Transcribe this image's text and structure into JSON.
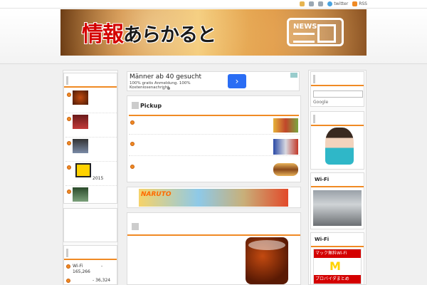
{
  "topbar": {
    "links": [
      {
        "label": "twitter",
        "icon": "twitter-icon"
      },
      {
        "label": "RSS",
        "icon": "rss-icon"
      }
    ]
  },
  "banner": {
    "title_kanji": "情報",
    "title_kana": "あらかると",
    "badge": "NEWS"
  },
  "ad": {
    "headline": "Männer ab 40 gesucht",
    "body": "100% gratis Anmeldung. 100% Kostenlosenachricht",
    "cta": "›"
  },
  "pickup": {
    "title": "Pickup"
  },
  "anime": {
    "logo": "NARUTO"
  },
  "left": {
    "items": [
      {
        "label": ""
      },
      {
        "label": ""
      },
      {
        "label": ""
      },
      {
        "label": "2015"
      },
      {
        "label": ""
      }
    ],
    "stats": [
      {
        "label": "Wi-Fi",
        "dash": "-",
        "value": "165,266"
      },
      {
        "label": "",
        "dash": "-",
        "value": "36,324"
      }
    ]
  },
  "right": {
    "google_label": "Google",
    "wifi1_title": "Wi-Fi",
    "wifi2_title": "Wi-Fi",
    "mac_top": "マック無料Wi-Fi",
    "mac_bottom": "プロバイダまとめ",
    "mac_logo": "M"
  },
  "colors": {
    "accent": "#f08a24",
    "brand_red": "#d40000",
    "ad_blue": "#2a6df4"
  }
}
